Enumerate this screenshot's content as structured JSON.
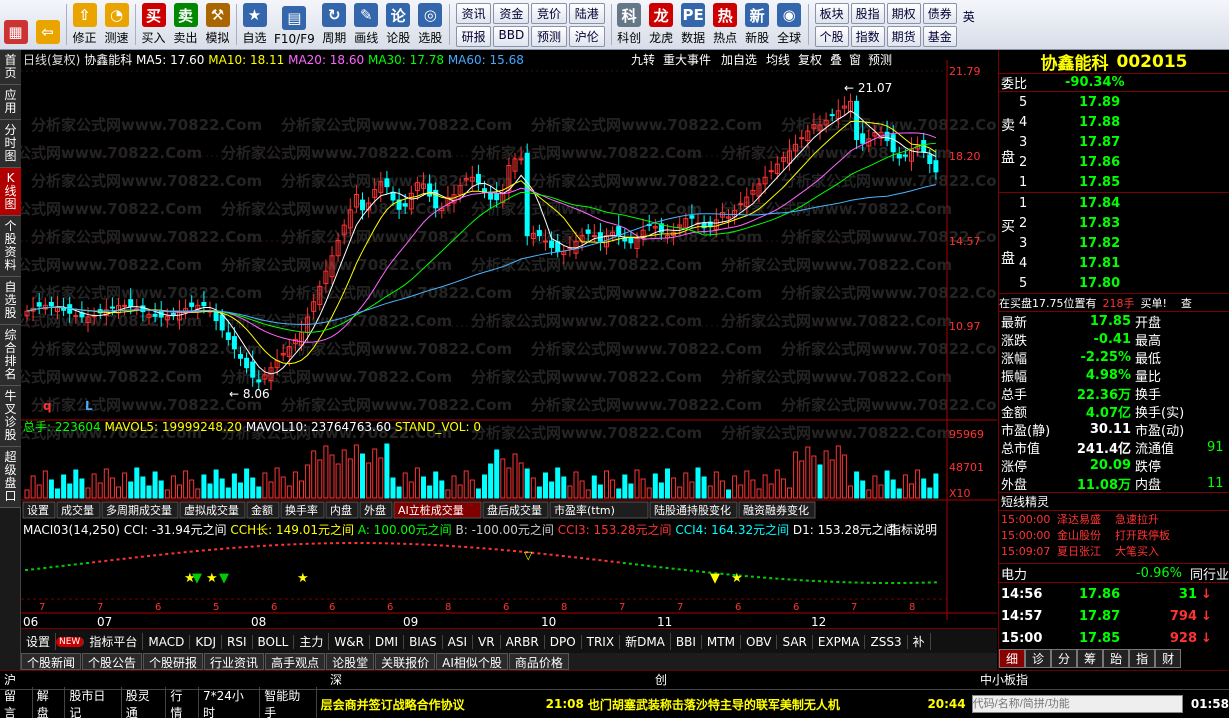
{
  "toolbar": {
    "buttons": [
      {
        "label": "",
        "icon": "windows-icon",
        "color": "#c33"
      },
      {
        "label": "",
        "icon": "back-arrow-icon",
        "color": "#e9a400"
      },
      {
        "label": "修正",
        "icon": "up-arrow-icon",
        "color": "#e9a400"
      },
      {
        "label": "测速",
        "icon": "gauge-icon",
        "color": "#e9a400"
      },
      {
        "label": "买入",
        "icon": "buy-icon",
        "color": "#c00"
      },
      {
        "label": "卖出",
        "icon": "sell-icon",
        "color": "#080"
      },
      {
        "label": "模拟",
        "icon": "hammer-icon",
        "color": "#a60"
      },
      {
        "label": "自选",
        "icon": "star-icon",
        "color": "#36a"
      },
      {
        "label": "F10/F9",
        "icon": "f10-icon",
        "color": "#36a"
      },
      {
        "label": "周期",
        "icon": "cycle-icon",
        "color": "#36a"
      },
      {
        "label": "画线",
        "icon": "pen-icon",
        "color": "#36a"
      },
      {
        "label": "论股",
        "icon": "discuss-icon",
        "color": "#36a"
      },
      {
        "label": "选股",
        "icon": "select-stock-icon",
        "color": "#36a"
      }
    ],
    "grid1": [
      "资讯",
      "资金",
      "竞价",
      "陆港",
      "研报",
      "BBD",
      "预测",
      "沪伦"
    ],
    "buttons2": [
      {
        "label": "科创",
        "icon": "kechuang-icon",
        "color": "#678"
      },
      {
        "label": "龙虎",
        "icon": "dragon-icon",
        "color": "#c00"
      },
      {
        "label": "数据",
        "icon": "pe-icon",
        "color": "#36a"
      },
      {
        "label": "热点",
        "icon": "hot-icon",
        "color": "#c00"
      },
      {
        "label": "新股",
        "icon": "new-stock-icon",
        "color": "#36a"
      },
      {
        "label": "全球",
        "icon": "globe-icon",
        "color": "#36a"
      }
    ],
    "grid2": [
      "板块",
      "股指",
      "期权",
      "债券",
      "个股",
      "指数",
      "期货",
      "基金"
    ],
    "extra": "英"
  },
  "leftnav": [
    "首页",
    "应用",
    "分时图",
    "K线图",
    "个股资料",
    "自选股",
    "综合排名",
    "牛叉诊股",
    "超级盘口"
  ],
  "chart": {
    "header": {
      "period": "日线(复权)",
      "name": "协鑫能科",
      "ma5": "MA5: 17.60",
      "ma10": "MA10: 18.11",
      "ma20": "MA20: 18.60",
      "ma30": "MA30: 17.78",
      "ma60": "MA60: 15.68"
    },
    "top_menu": [
      "九转",
      "重大事件",
      "加自选",
      "均线",
      "复权",
      "叠",
      "窗",
      "预测"
    ],
    "price_ticks": [
      "21.79",
      "18.20",
      "14.57",
      "10.97"
    ],
    "high_label": "21.07",
    "low_label": "8.06",
    "markers": {
      "q": "q",
      "l": "L"
    },
    "vol_header": {
      "total": "总手: 223604",
      "mavol5": "MAVOL5: 19999248.20",
      "mavol10": "MAVOL10: 23764763.60",
      "stand": "STAND_VOL: 0"
    },
    "vol_ticks": [
      "95969",
      "48701",
      "X10"
    ],
    "sub_tabs": [
      "设置",
      "成交量",
      "多周期成交量",
      "虚拟成交量",
      "金额",
      "换手率",
      "内盘",
      "外盘",
      "AI立桩成交量",
      "盘后成交量",
      "市盈率(ttm)",
      "陆股通持股变化",
      "融资融券变化"
    ],
    "sub_tab_selected": 8,
    "macd_header": {
      "name": "MACI03(14,250)",
      "cci": "CCI: -31.94元之间",
      "cch": "CCH长: 149.01元之间",
      "a": "A: 100.00元之间",
      "b": "B: -100.00元之间",
      "cci3": "CCI3: 153.28元之间",
      "cci4": "CCI4: 164.32元之间",
      "d1": "D1: 153.28元之间"
    },
    "indicator_explain": "指标说明",
    "bottom_numbers": [
      "7",
      "7",
      "6",
      "5",
      "6",
      "6",
      "6",
      "8",
      "6",
      "8",
      "7",
      "7",
      "6",
      "6",
      "7",
      "8"
    ],
    "months": [
      "06",
      "07",
      "08",
      "09",
      "10",
      "11",
      "12"
    ],
    "watermark": "分析家公式网www.70822.Com"
  },
  "indicators": [
    "设置",
    "NEW",
    "指标平台",
    "MACD",
    "KDJ",
    "RSI",
    "BOLL",
    "主力",
    "W&R",
    "DMI",
    "BIAS",
    "ASI",
    "VR",
    "ARBR",
    "DPO",
    "TRIX",
    "新DMA",
    "BBI",
    "MTM",
    "OBV",
    "SAR",
    "EXPMA",
    "ZSS3",
    "补"
  ],
  "info_tabs": [
    "个股新闻",
    "个股公告",
    "个股研报",
    "行业资讯",
    "高手观点",
    "论股堂",
    "关联报价",
    "AI相似个股",
    "商品价格"
  ],
  "right": {
    "title": "协鑫能科",
    "code": "002015",
    "weibi_label": "委比",
    "weibi": "-90.34%",
    "sell": [
      {
        "n": "5",
        "p": "17.89"
      },
      {
        "n": "4",
        "p": "17.88"
      },
      {
        "n": "3",
        "p": "17.87"
      },
      {
        "n": "2",
        "p": "17.86"
      },
      {
        "n": "1",
        "p": "17.85"
      }
    ],
    "sell_label": "卖盘",
    "buy": [
      {
        "n": "1",
        "p": "17.84"
      },
      {
        "n": "2",
        "p": "17.83"
      },
      {
        "n": "3",
        "p": "17.82"
      },
      {
        "n": "4",
        "p": "17.81"
      },
      {
        "n": "5",
        "p": "17.80"
      }
    ],
    "buy_label": "买盘",
    "notice": "在买盘17.75位置有",
    "notice_qty": "218手",
    "notice_act": "买单!",
    "notice_more": "查",
    "stats": [
      {
        "l": "最新",
        "v": "17.85",
        "l2": "开盘",
        "v2": ""
      },
      {
        "l": "涨跌",
        "v": "-0.41",
        "l2": "最高",
        "v2": ""
      },
      {
        "l": "涨幅",
        "v": "-2.25%",
        "l2": "最低",
        "v2": ""
      },
      {
        "l": "振幅",
        "v": "4.98%",
        "l2": "量比",
        "v2": ""
      },
      {
        "l": "总手",
        "v": "22.36万",
        "l2": "换手",
        "v2": ""
      },
      {
        "l": "金额",
        "v": "4.07亿",
        "l2": "换手(实)",
        "v2": ""
      },
      {
        "l": "市盈(静)",
        "v": "30.11",
        "l2": "市盈(动)",
        "v2": ""
      },
      {
        "l": "总市值",
        "v": "241.4亿",
        "l2": "流通值",
        "v2": "91"
      },
      {
        "l": "涨停",
        "v": "20.09",
        "l2": "跌停",
        "v2": ""
      },
      {
        "l": "外盘",
        "v": "11.08万",
        "l2": "内盘",
        "v2": "11"
      }
    ],
    "sprite_title": "短线精灵",
    "sprites": [
      {
        "t": "15:00:00",
        "n": "泽达易盛",
        "e": "急速拉升"
      },
      {
        "t": "15:00:00",
        "n": "金山股份",
        "e": "打开跌停板"
      },
      {
        "t": "15:09:07",
        "n": "夏日张江",
        "e": "大笔买入"
      }
    ],
    "sector": "电力",
    "sector_pct": "-0.96%",
    "sector_btn": "同行业",
    "ticks": [
      {
        "t": "14:56",
        "p": "17.86",
        "v": "31",
        "dir": "down"
      },
      {
        "t": "14:57",
        "p": "17.87",
        "v": "794",
        "dir": "down"
      },
      {
        "t": "15:00",
        "p": "17.85",
        "v": "928",
        "dir": "down"
      }
    ],
    "bottom_tabs": [
      "细",
      "诊",
      "分",
      "筹",
      "跆",
      "指",
      "财"
    ]
  },
  "status1": {
    "sh": "沪",
    "sz": "深",
    "cy": "创",
    "zx": "中小板指"
  },
  "status2": {
    "items": [
      "留言",
      "解盘",
      "股市日记",
      "股灵通",
      "行情",
      "7*24小时",
      "智能助手"
    ],
    "news1": "层会商并签订战略合作协议",
    "news2_time": "21:08",
    "news2": "也门胡塞武装称击落沙特主导的联军美制无人机",
    "news3_time": "20:44",
    "search_placeholder": "代码/名称/简拼/功能",
    "clock": "01:58"
  },
  "colors": {
    "up": "#ff3232",
    "down": "#00ffff",
    "ma5": "#ffffff",
    "ma10": "#ffff00",
    "ma20": "#ff66ff",
    "ma30": "#00ff00",
    "ma60": "#4ab4ff",
    "axis": "#b00000"
  }
}
